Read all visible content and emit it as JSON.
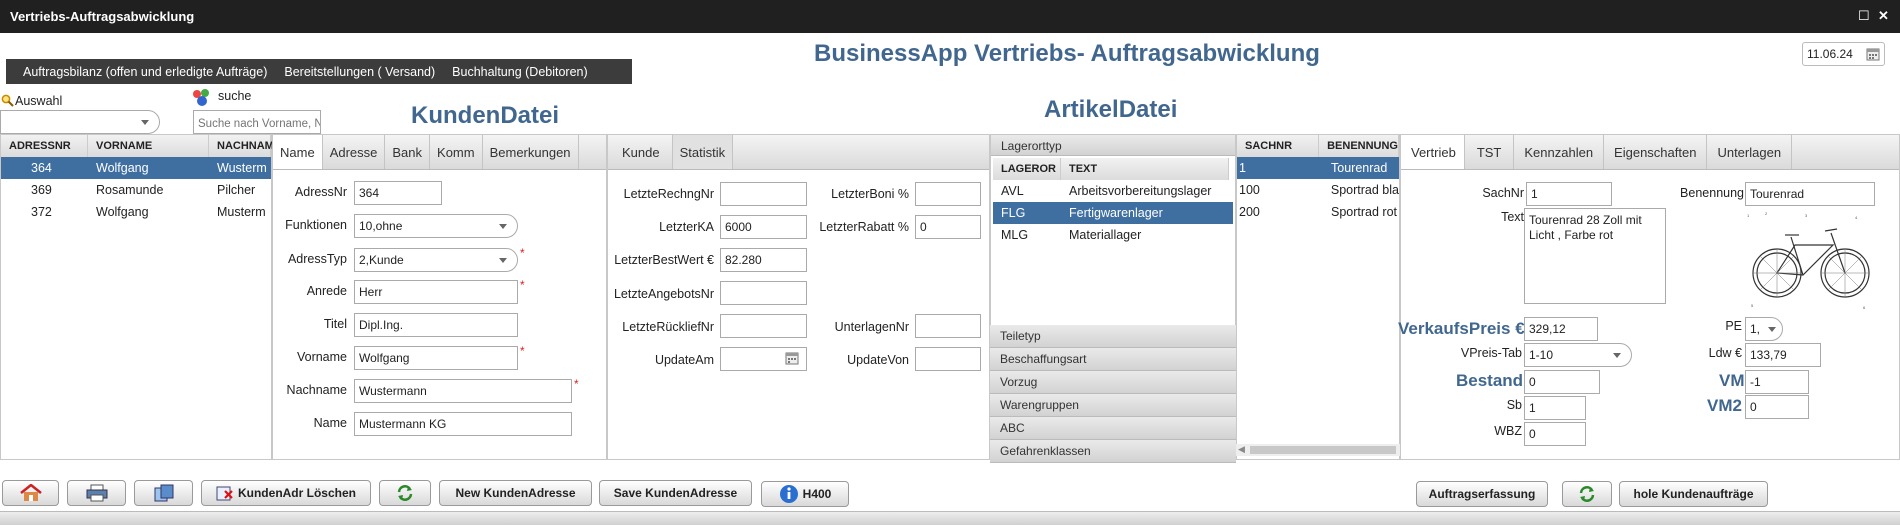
{
  "window": {
    "title": "Vertriebs-Auftragsabwicklung"
  },
  "menu": [
    "Auftragsbilanz (offen und erledigte Aufträge)",
    "Bereitstellungen ( Versand)",
    "Buchhaltung (Debitoren)"
  ],
  "app_title": "BusinessApp Vertriebs- Auftragsabwicklung",
  "date": "11.06.24",
  "auswahl": {
    "label": "Auswahl"
  },
  "suche": {
    "label": "suche",
    "placeholder": "Suche nach Vorname, N"
  },
  "kunden": {
    "heading": "KundenDatei",
    "columns": [
      "ADRESSNR",
      "VORNAME",
      "NACHNAM"
    ],
    "rows": [
      [
        "364",
        "Wolfgang",
        "Wusterm"
      ],
      [
        "369",
        "Rosamunde",
        "Pilcher"
      ],
      [
        "372",
        "Wolfgang",
        "Musterm"
      ]
    ],
    "tabs": [
      "Name",
      "Adresse",
      "Bank",
      "Komm",
      "Bemerkungen"
    ],
    "fields": {
      "adressnr": {
        "label": "AdressNr",
        "value": "364"
      },
      "funktionen": {
        "label": "Funktionen",
        "value": "10,ohne"
      },
      "adresstyp": {
        "label": "AdressTyp",
        "value": "2,Kunde"
      },
      "anrede": {
        "label": "Anrede",
        "value": "Herr"
      },
      "titel": {
        "label": "Titel",
        "value": "Dipl.Ing."
      },
      "vorname": {
        "label": "Vorname",
        "value": "Wolfgang"
      },
      "nachname": {
        "label": "Nachname",
        "value": "Wustermann"
      },
      "name": {
        "label": "Name",
        "value": "Mustermann KG"
      }
    },
    "required_mark": "*"
  },
  "statistik": {
    "tabs": [
      "Kunde",
      "Statistik"
    ],
    "left": [
      {
        "label": "LetzteRechngNr",
        "value": ""
      },
      {
        "label": "LetzterKA",
        "value": "6000"
      },
      {
        "label": "LetzterBestWert €",
        "value": "82.280"
      },
      {
        "label": "LetzteAngebotsNr",
        "value": ""
      },
      {
        "label": "LetzteRückliefNr",
        "value": ""
      },
      {
        "label": "UpdateAm",
        "value": ""
      }
    ],
    "right": [
      {
        "label": "LetzterBoni %",
        "value": ""
      },
      {
        "label": "LetzterRabatt %",
        "value": "0"
      },
      {
        "label": "UnterlagenNr",
        "value": ""
      },
      {
        "label": "UpdateVon",
        "value": ""
      }
    ]
  },
  "artikel": {
    "heading": "ArtikelDatei",
    "lagerorttyp": {
      "title": "Lagerorttyp",
      "columns": [
        "LAGEROR",
        "TEXT"
      ],
      "rows": [
        [
          "AVL",
          "Arbeitsvorbereitungslager"
        ],
        [
          "FLG",
          "Fertigwarenlager"
        ],
        [
          "MLG",
          "Materiallager"
        ]
      ]
    },
    "accordion": [
      "Teiletyp",
      "Beschaffungsart",
      "Vorzug",
      "Warengruppen",
      "ABC",
      "Gefahrenklassen"
    ],
    "list": {
      "columns": [
        "SACHNR",
        "BENENNUNG"
      ],
      "rows": [
        [
          "1",
          "Tourenrad"
        ],
        [
          "100",
          "Sportrad bla"
        ],
        [
          "200",
          "Sportrad rot"
        ]
      ]
    },
    "tabs": [
      "Vertrieb",
      "TST",
      "Kennzahlen",
      "Eigenschaften",
      "Unterlagen"
    ],
    "detail": {
      "sachnr": {
        "label": "SachNr",
        "value": "1"
      },
      "benennung": {
        "label": "Benennung",
        "value": "Tourenrad"
      },
      "text": {
        "label": "Text",
        "value": "Tourenrad 28 Zoll mit Licht , Farbe rot"
      },
      "verkaufspreis": {
        "label": "VerkaufsPreis €",
        "value": "329,12"
      },
      "pe": {
        "label": "PE",
        "value": "1,"
      },
      "vpreis_tab": {
        "label": "VPreis-Tab",
        "value": "1-10"
      },
      "ldw": {
        "label": "Ldw €",
        "value": "133,79"
      },
      "bestand": {
        "label": "Bestand",
        "value": "0"
      },
      "vm": {
        "label": "VM",
        "value": "-1"
      },
      "sb": {
        "label": "Sb",
        "value": "1"
      },
      "vm2": {
        "label": "VM2",
        "value": "0"
      },
      "wbz": {
        "label": "WBZ",
        "value": "0"
      }
    }
  },
  "footer": {
    "kundenadr_loeschen": "KundenAdr Löschen",
    "new_kundenadresse": "New KundenAdresse",
    "save_kundenadresse": "Save KundenAdresse",
    "h400": "H400",
    "auftragserfassung": "Auftragserfassung",
    "hole_kundenauftraege": "hole Kundenaufträge"
  },
  "colors": {
    "accent": "#41678f",
    "selected_row": "#3f6fa0",
    "required": "#dd2222",
    "titlebar": "#202020"
  }
}
